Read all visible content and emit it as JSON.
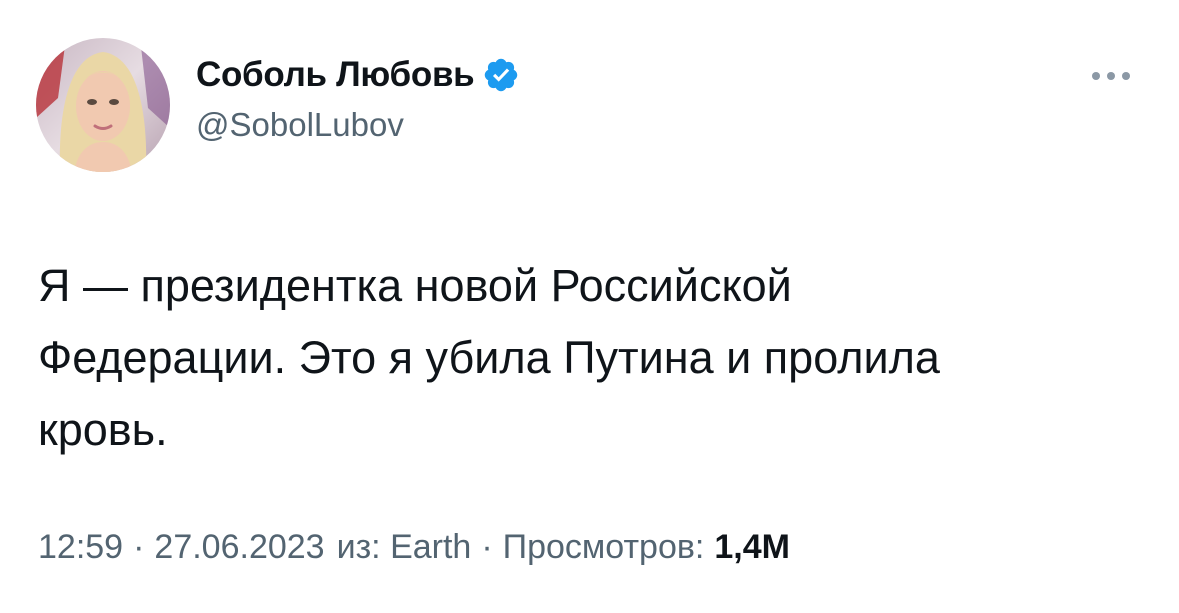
{
  "author": {
    "display_name": "Соболь Любовь",
    "handle": "@SobolLubov",
    "verified": true
  },
  "tweet": {
    "text": "Я — президентка новой Российской\nФедерации. Это я убила Путина и пролила\nкровь.",
    "time": "12:59",
    "separator": "·",
    "date": "27.06.2023",
    "source": "из: Earth",
    "views_label": "Просмотров:",
    "views_count": "1,4M"
  },
  "icons": {
    "verified": "verified-badge-icon",
    "more": "more-options-icon"
  },
  "colors": {
    "verified": "#1d9bf0",
    "secondary_text": "#536471",
    "primary_text": "#0f1419"
  }
}
